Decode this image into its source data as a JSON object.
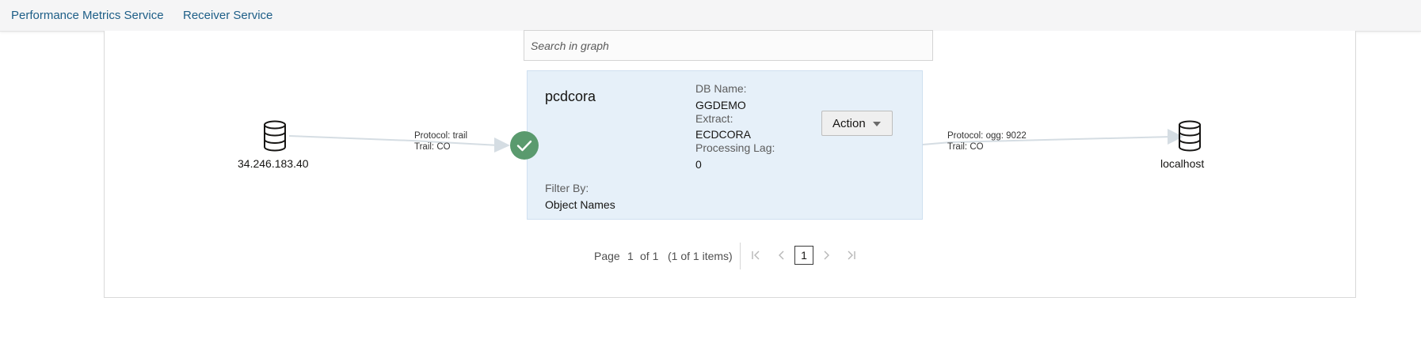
{
  "nav": {
    "items": [
      "Performance Metrics Service",
      "Receiver Service"
    ]
  },
  "search": {
    "placeholder": "Search in graph"
  },
  "graph": {
    "source": {
      "label": "34.246.183.40",
      "icon": "database-icon"
    },
    "target": {
      "label": "localhost",
      "icon": "database-icon"
    },
    "left_edge": {
      "protocol": "Protocol: trail",
      "trail": "Trail: CO"
    },
    "right_edge": {
      "protocol": "Protocol: ogg: 9022",
      "trail": "Trail: CO"
    },
    "card": {
      "name": "pcdcora",
      "status": "success",
      "db_name_label": "DB Name:",
      "db_name": "GGDEMO",
      "extract_label": "Extract:",
      "extract": "ECDCORA",
      "lag_label": "Processing Lag:",
      "lag": "0",
      "filter_label": "Filter By:",
      "filter": "Object Names",
      "action_label": "Action"
    }
  },
  "pagination": {
    "page_label": "Page",
    "page": "1",
    "of_label": "of 1",
    "items_text": "(1 of 1 items)",
    "current": "1"
  },
  "colors": {
    "link": "#1d5e87",
    "card_bg": "#e6f0f9",
    "status_ok": "#5a9a6e",
    "edge": "#d5dde3"
  }
}
